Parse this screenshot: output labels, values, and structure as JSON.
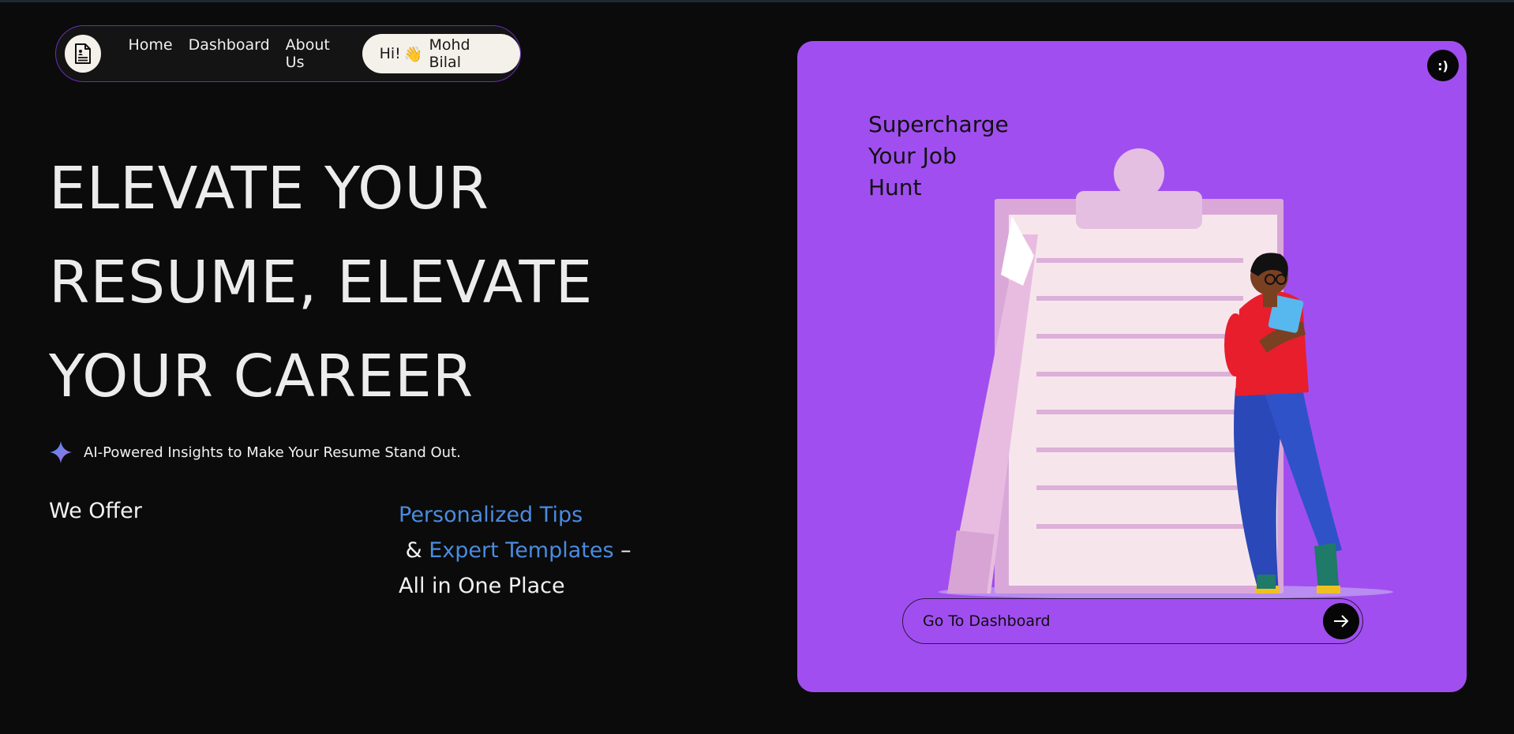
{
  "nav": {
    "logo_icon": "resume-document-icon",
    "links": [
      "Home",
      "Dashboard",
      "About Us"
    ],
    "greeting_prefix": "Hi!",
    "greeting_emoji": "👋",
    "user_name": "Mohd Bilal"
  },
  "hero": {
    "lines": [
      "ELEVATE YOUR",
      "RESUME, ELEVATE",
      "YOUR CAREER"
    ]
  },
  "ai_line": {
    "icon": "sparkle-icon",
    "text": "AI-Powered Insights to Make Your Resume Stand Out."
  },
  "offer": {
    "label": "We Offer",
    "highlight1": "Personalized Tips",
    "amp": " & ",
    "highlight2": "Expert Templates",
    "rest": " – All in One Place"
  },
  "card": {
    "badge": ":)",
    "title_lines": [
      "Supercharge",
      "Your Job",
      "Hunt"
    ],
    "button_label": "Go To Dashboard",
    "button_icon": "arrow-right-icon"
  },
  "colors": {
    "background": "#0b0b0b",
    "card": "#a14ef0",
    "highlight": "#4a8be0",
    "nav_border": "#6a2fb3"
  }
}
